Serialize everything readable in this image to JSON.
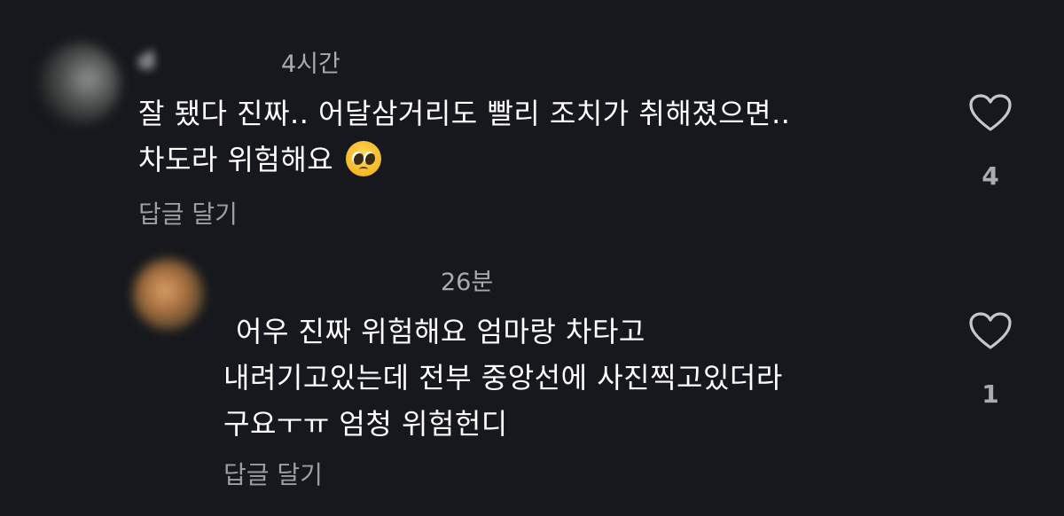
{
  "comments": [
    {
      "username": "d",
      "time": "4시간",
      "lines": [
        "잘 됐다 진짜.. 어달삼거리도 빨리 조치가 취해졌으면..",
        "차도라 위험해요"
      ],
      "emoji": "pleading-face-emoji",
      "reply_label": "답글 달기",
      "likes": "4"
    },
    {
      "username": "",
      "time": "26분",
      "mention": "",
      "lines": [
        "어우 진짜 위험해요 엄마랑 차타고",
        "내려기고있는데 전부 중앙선에 사진찍고있더라",
        "구요ㅜㅠ  엄청 위험헌디"
      ],
      "reply_label": "답글 달기",
      "likes": "1"
    }
  ],
  "icons": {
    "like": "heart-outline-icon"
  },
  "colors": {
    "background": "#16181d",
    "text": "#ffffff",
    "secondary_text": "#a7abb2",
    "mention": "#6e8ff0"
  }
}
